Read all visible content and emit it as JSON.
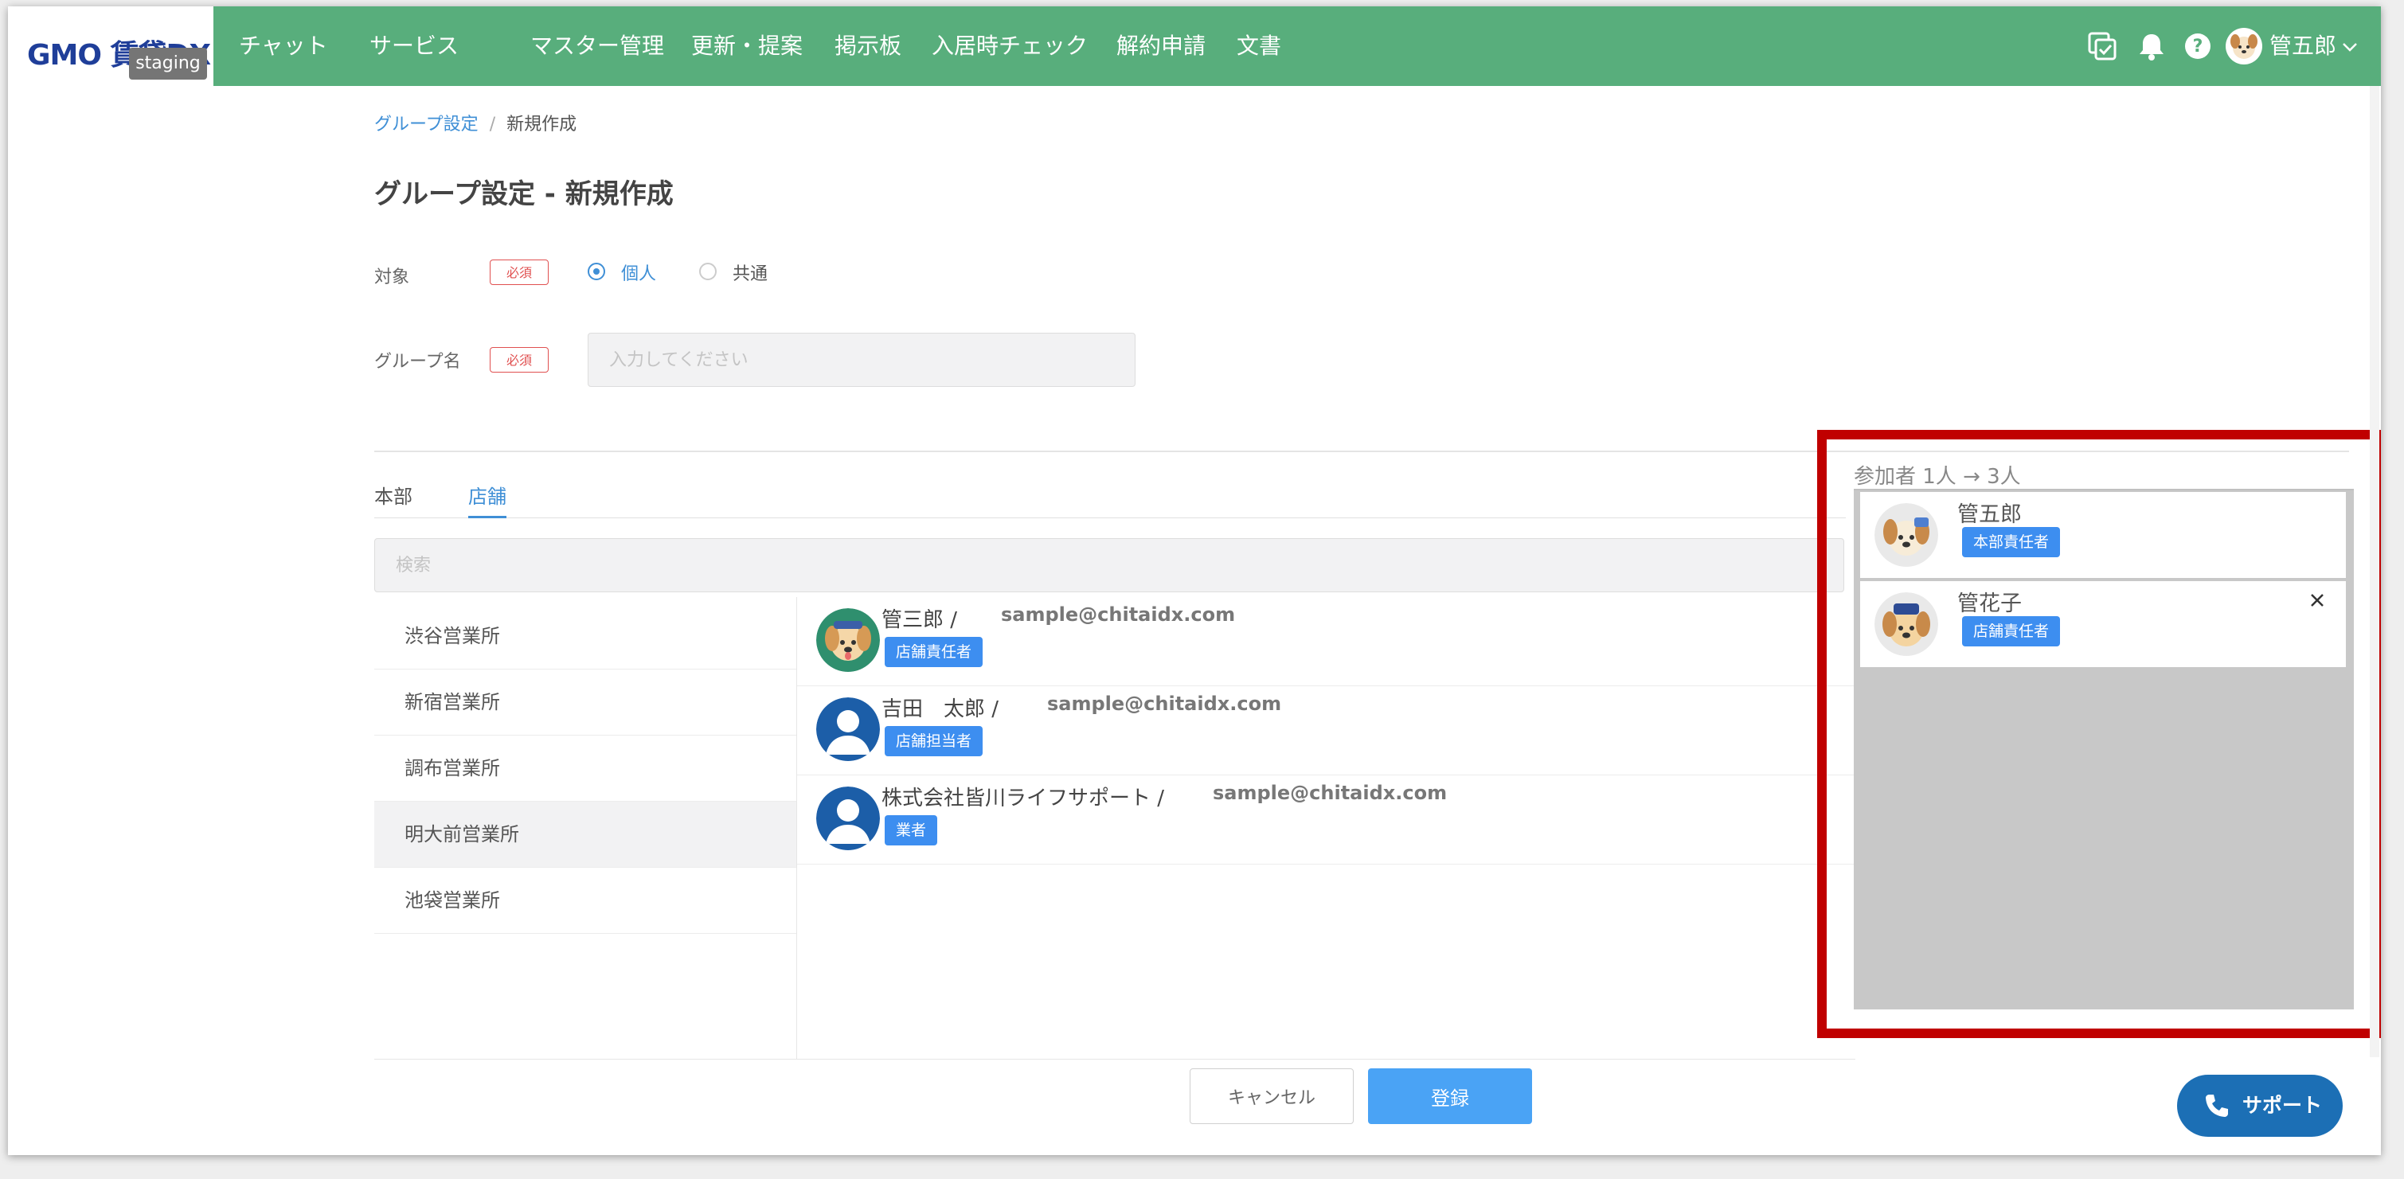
{
  "header": {
    "logo": "GMO 賃貸DX",
    "env_badge": "staging",
    "nav": [
      "チャット",
      "サービス",
      "マスター管理",
      "更新・提案",
      "掲示板",
      "入居時チェック",
      "解約申請",
      "文書"
    ],
    "user_name": "管五郎",
    "brand_color": "#58ae7c"
  },
  "breadcrumb": {
    "parent": "グループ設定",
    "separator": "/",
    "current": "新規作成"
  },
  "page_title": "グループ設定 - 新規作成",
  "form": {
    "target_label": "対象",
    "required_badge": "必須",
    "target_options": [
      {
        "label": "個人",
        "selected": true
      },
      {
        "label": "共通",
        "selected": false
      }
    ],
    "group_name_label": "グループ名",
    "group_name_placeholder": "入力してください",
    "group_name_value": ""
  },
  "tabs": [
    {
      "label": "本部",
      "active": false
    },
    {
      "label": "店舗",
      "active": true
    }
  ],
  "search": {
    "placeholder": "検索"
  },
  "offices": [
    {
      "label": "渋谷営業所",
      "selected": false
    },
    {
      "label": "新宿営業所",
      "selected": false
    },
    {
      "label": "調布営業所",
      "selected": false
    },
    {
      "label": "明大前営業所",
      "selected": true
    },
    {
      "label": "池袋営業所",
      "selected": false
    }
  ],
  "members": [
    {
      "name": "管三郎 /",
      "email": "sample@chitaidx.com",
      "role": "店舗責任者",
      "avatar": "dog-avatar"
    },
    {
      "name": "吉田　太郎 /",
      "email": "sample@chitaidx.com",
      "role": "店舗担当者",
      "avatar": "user-silhouette"
    },
    {
      "name": "株式会社皆川ライフサポート /",
      "email": "sample@chitaidx.com",
      "role": "業者",
      "avatar": "user-silhouette"
    }
  ],
  "participants": {
    "title": "参加者 1人 → 3人",
    "items": [
      {
        "name": "管五郎",
        "role": "本部責任者",
        "removable": false,
        "avatar": "dog-avatar"
      },
      {
        "name": "管花子",
        "role": "店舗責任者",
        "removable": true,
        "avatar": "dog-avatar"
      }
    ]
  },
  "buttons": {
    "cancel": "キャンセル",
    "submit": "登録",
    "support": "サポート"
  },
  "colors": {
    "accent": "#3f8fd6",
    "badge": "#3d8ef0",
    "highlight_frame": "#c00000",
    "support": "#1c6fb5"
  }
}
